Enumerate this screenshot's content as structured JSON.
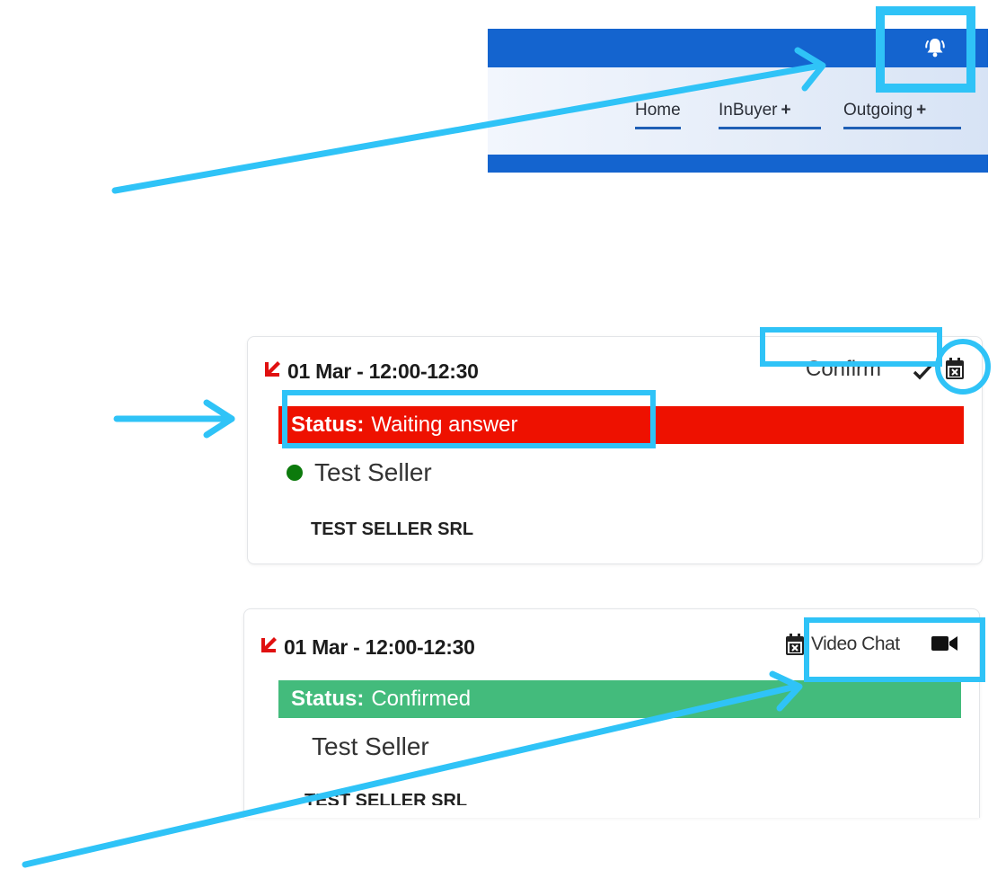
{
  "nav": {
    "items": [
      {
        "label": "Home",
        "plus": ""
      },
      {
        "label": "InBuyer",
        "plus": "+"
      },
      {
        "label": "Outgoing",
        "plus": "+"
      }
    ],
    "bell_icon": "bell-ringing-icon"
  },
  "cards": [
    {
      "direction_icon": "arrow-down-left-icon",
      "datetime": "01 Mar - 12:00-12:30",
      "action_label": "Confirm",
      "action_icon": "check-icon",
      "calendar_icon": "calendar-cancel-icon",
      "status_label": "Status:",
      "status_value": "Waiting answer",
      "status_color": "#ee1100",
      "online_dot_color": "#0c7a0c",
      "seller_name": "Test Seller",
      "company": "TEST SELLER SRL"
    },
    {
      "direction_icon": "arrow-down-left-icon",
      "datetime": "01 Mar - 12:00-12:30",
      "calendar_icon": "calendar-cancel-icon",
      "action_label": "Video Chat",
      "action_icon": "video-camera-icon",
      "status_label": "Status:",
      "status_value": "Confirmed",
      "status_color": "#43bb7c",
      "seller_name": "Test Seller",
      "company": "TEST SELLER SRL"
    }
  ],
  "colors": {
    "nav_blue": "#1464cf",
    "annotation_blue": "#2fc3f7",
    "direction_red": "#e01010"
  }
}
